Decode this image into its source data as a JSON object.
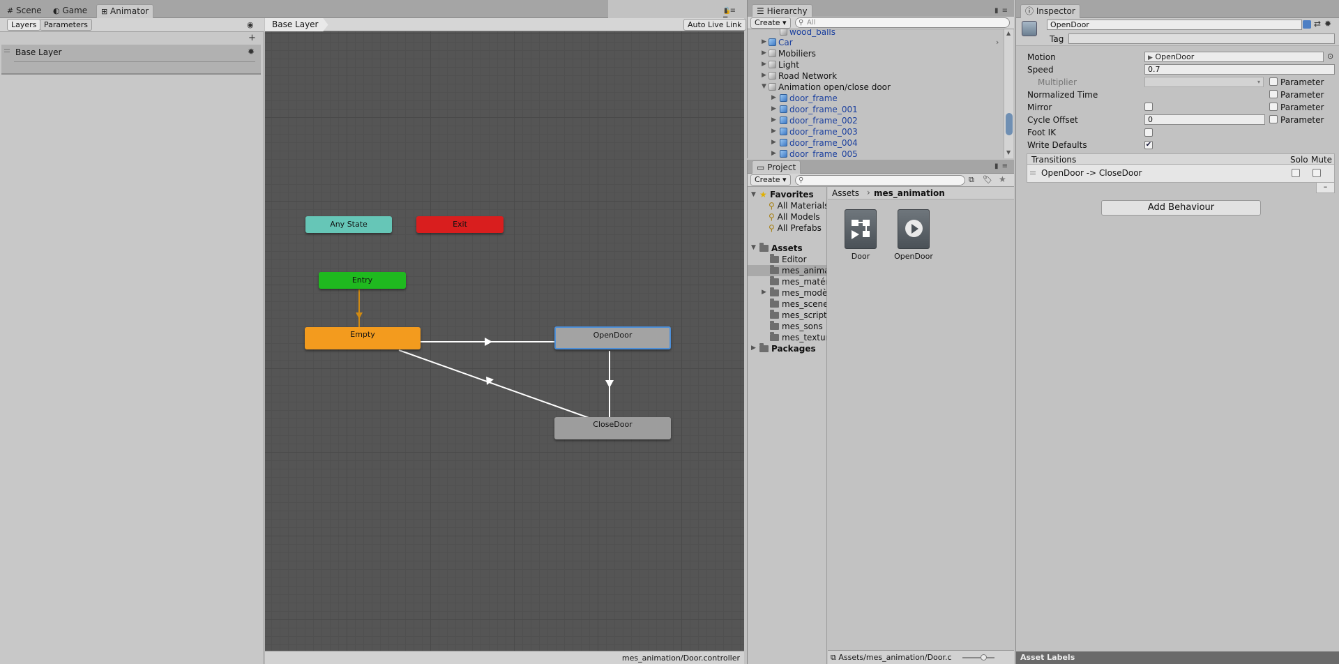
{
  "animator_panel": {
    "tabs": [
      "Scene",
      "Game",
      "Animator"
    ],
    "sub_tabs": [
      "Layers",
      "Parameters"
    ],
    "layer_name": "Base Layer",
    "breadcrumb": "Base Layer",
    "auto_live_link": "Auto Live Link",
    "footer_path": "mes_animation/Door.controller",
    "states": {
      "any_state": "Any State",
      "exit": "Exit",
      "entry": "Entry",
      "empty": "Empty",
      "open_door": "OpenDoor",
      "close_door": "CloseDoor"
    },
    "colors": {
      "any_state": "#66c6b7",
      "exit": "#d91e1e",
      "entry": "#1fb91f",
      "default_state": "#f39b1e",
      "state": "#9d9d9d",
      "selection": "#4d8fd8",
      "grid_bg": "#555555"
    }
  },
  "hierarchy": {
    "title": "Hierarchy",
    "create": "Create",
    "search_placeholder": "All",
    "items": [
      {
        "label": "wood_balls",
        "type": "prefab-child"
      },
      {
        "label": "Car",
        "type": "prefab"
      },
      {
        "label": "Mobiliers",
        "type": "object"
      },
      {
        "label": "Light",
        "type": "object"
      },
      {
        "label": "Road Network",
        "type": "object"
      },
      {
        "label": "Animation open/close door",
        "type": "object-expanded"
      },
      {
        "label": "door_frame",
        "type": "prefab-child"
      },
      {
        "label": "door_frame_001",
        "type": "prefab-child"
      },
      {
        "label": "door_frame_002",
        "type": "prefab-child"
      },
      {
        "label": "door_frame_003",
        "type": "prefab-child"
      },
      {
        "label": "door_frame_004",
        "type": "prefab-child"
      },
      {
        "label": "door_frame_005",
        "type": "prefab-child"
      }
    ]
  },
  "project": {
    "title": "Project",
    "create": "Create",
    "favorites": "Favorites",
    "favorite_items": [
      "All Materials",
      "All Models",
      "All Prefabs"
    ],
    "assets": "Assets",
    "asset_folders": [
      "Editor",
      "mes_anima",
      "mes_matér",
      "mes_modèl",
      "mes_scenes",
      "mes_scripts",
      "mes_sons",
      "mes_textur"
    ],
    "packages": "Packages",
    "breadcrumb_root": "Assets",
    "breadcrumb_current": "mes_animation",
    "files": [
      {
        "name": "Door",
        "icon": "animator-controller-icon"
      },
      {
        "name": "OpenDoor",
        "icon": "animation-clip-icon"
      }
    ],
    "footer_path": "Assets/mes_animation/Door.c"
  },
  "inspector": {
    "title": "Inspector",
    "object_name": "OpenDoor",
    "tag_label": "Tag",
    "fields": {
      "motion_label": "Motion",
      "motion_value": "OpenDoor",
      "speed_label": "Speed",
      "speed_value": "0.7",
      "multiplier_label": "Multiplier",
      "normalized_time_label": "Normalized Time",
      "mirror_label": "Mirror",
      "cycle_offset_label": "Cycle Offset",
      "cycle_offset_value": "0",
      "foot_ik_label": "Foot IK",
      "write_defaults_label": "Write Defaults",
      "parameter_label": "Parameter"
    },
    "transitions_header": "Transitions",
    "solo_label": "Solo",
    "mute_label": "Mute",
    "transition_item": "OpenDoor -> CloseDoor",
    "add_behaviour": "Add Behaviour",
    "asset_labels": "Asset Labels"
  }
}
